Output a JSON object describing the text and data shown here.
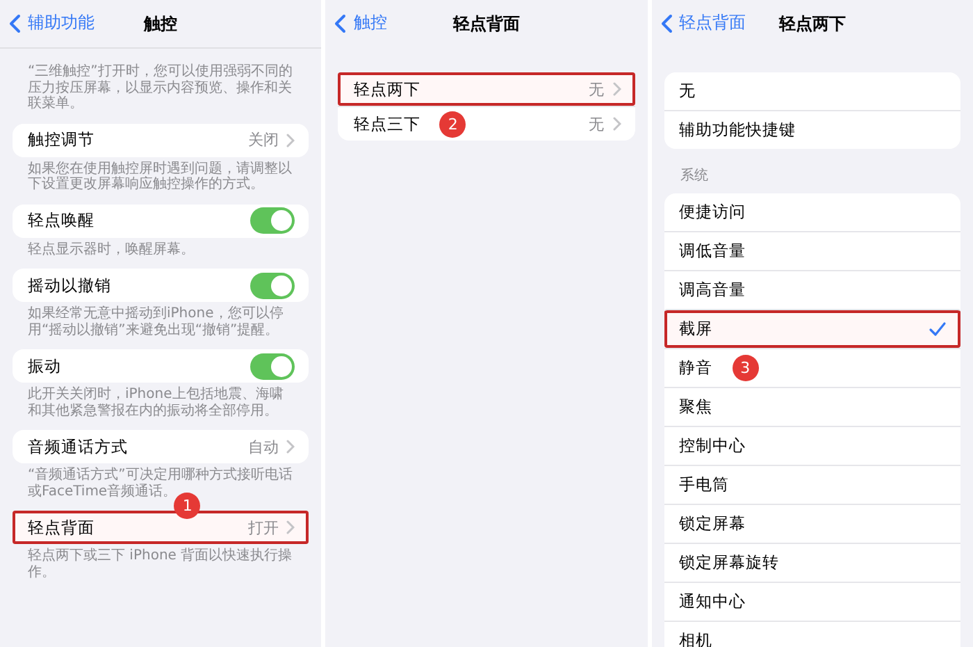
{
  "panels": [
    {
      "back": "辅助功能",
      "title": "触控",
      "sections": [
        {
          "footer": "“三维触控”打开时，您可以使用强弱不同的压力按压屏幕，以显示内容预览、操作和关联菜单。"
        },
        {
          "rows": [
            {
              "kind": "value",
              "label": "触控调节",
              "value": "关闭",
              "highlighted": false
            }
          ],
          "footer": "如果您在使用触控屏时遇到问题，请调整以下设置更改屏幕响应触控操作的方式。"
        },
        {
          "rows": [
            {
              "kind": "toggle",
              "label": "轻点唤醒",
              "on": true,
              "highlighted": false
            }
          ],
          "footer": "轻点显示器时，唤醒屏幕。"
        },
        {
          "rows": [
            {
              "kind": "toggle",
              "label": "摇动以撤销",
              "on": true,
              "highlighted": false
            }
          ],
          "footer": "如果经常无意中摇动到iPhone，您可以停用“摇动以撤销”来避免出现“撤销”提醒。"
        },
        {
          "rows": [
            {
              "kind": "toggle",
              "label": "振动",
              "on": true,
              "highlighted": false
            }
          ],
          "footer": "此开关关闭时，iPhone上包括地震、海啸和其他紧急警报在内的振动将全部停用。"
        },
        {
          "rows": [
            {
              "kind": "value",
              "label": "音频通话方式",
              "value": "自动",
              "highlighted": false
            }
          ],
          "footer": "“音频通话方式”可决定用哪种方式接听电话或FaceTime音频通话。",
          "footer_badge": "1"
        },
        {
          "rows": [
            {
              "kind": "value",
              "label": "轻点背面",
              "value": "打开",
              "highlighted": true
            }
          ],
          "footer": "轻点两下或三下 iPhone 背面以快速执行操作。"
        }
      ]
    },
    {
      "back": "触控",
      "title": "轻点背面",
      "sections": [
        {
          "rows": [
            {
              "kind": "value",
              "label": "轻点两下",
              "value": "无",
              "highlighted": true
            },
            {
              "kind": "value",
              "label": "轻点三下",
              "value": "无",
              "highlighted": false,
              "badge": "2"
            }
          ]
        }
      ]
    },
    {
      "back": "轻点背面",
      "title": "轻点两下",
      "sections": [
        {
          "rows": [
            {
              "kind": "option",
              "label": "无",
              "checked": false,
              "highlighted": false
            },
            {
              "kind": "option",
              "label": "辅助功能快捷键",
              "checked": false,
              "highlighted": false
            }
          ]
        },
        {
          "header": "系统",
          "rows": [
            {
              "kind": "option",
              "label": "便捷访问",
              "checked": false,
              "highlighted": false
            },
            {
              "kind": "option",
              "label": "调低音量",
              "checked": false,
              "highlighted": false
            },
            {
              "kind": "option",
              "label": "调高音量",
              "checked": false,
              "highlighted": false
            },
            {
              "kind": "option",
              "label": "截屏",
              "checked": true,
              "highlighted": true
            },
            {
              "kind": "option",
              "label": "静音",
              "checked": false,
              "highlighted": false,
              "badge": "3"
            },
            {
              "kind": "option",
              "label": "聚焦",
              "checked": false,
              "highlighted": false
            },
            {
              "kind": "option",
              "label": "控制中心",
              "checked": false,
              "highlighted": false
            },
            {
              "kind": "option",
              "label": "手电筒",
              "checked": false,
              "highlighted": false
            },
            {
              "kind": "option",
              "label": "锁定屏幕",
              "checked": false,
              "highlighted": false
            },
            {
              "kind": "option",
              "label": "锁定屏幕旋转",
              "checked": false,
              "highlighted": false
            },
            {
              "kind": "option",
              "label": "通知中心",
              "checked": false,
              "highlighted": false
            },
            {
              "kind": "option",
              "label": "相机",
              "checked": false,
              "highlighted": false
            }
          ]
        }
      ]
    }
  ]
}
